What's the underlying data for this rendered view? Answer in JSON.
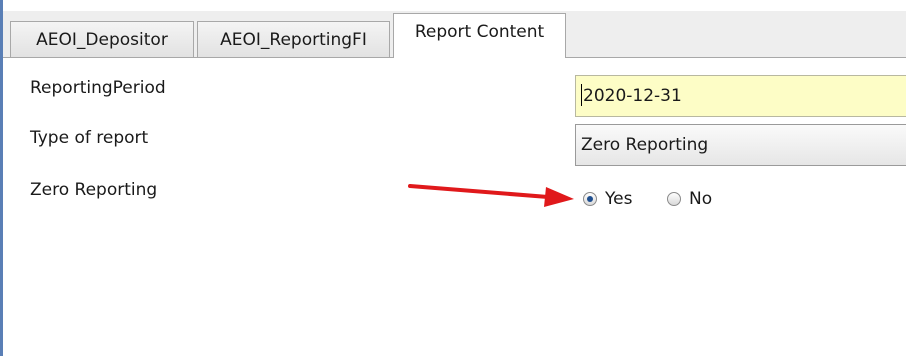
{
  "tabs": [
    {
      "label": "AEOI_Depositor"
    },
    {
      "label": "AEOI_ReportingFI"
    },
    {
      "label": "Report Content"
    }
  ],
  "form": {
    "reporting_period": {
      "label": "ReportingPeriod",
      "value": "2020-12-31"
    },
    "type_of_report": {
      "label": "Type of report",
      "value": "Zero Reporting"
    },
    "zero_reporting": {
      "label": "Zero Reporting",
      "options": [
        "Yes",
        "No"
      ],
      "selected": "Yes"
    }
  },
  "colors": {
    "date_field_bg": "#fdfdc6",
    "annotation_arrow": "#e0191b",
    "radio_selected": "#1f4f8f",
    "window_border": "#5a7fb6"
  }
}
